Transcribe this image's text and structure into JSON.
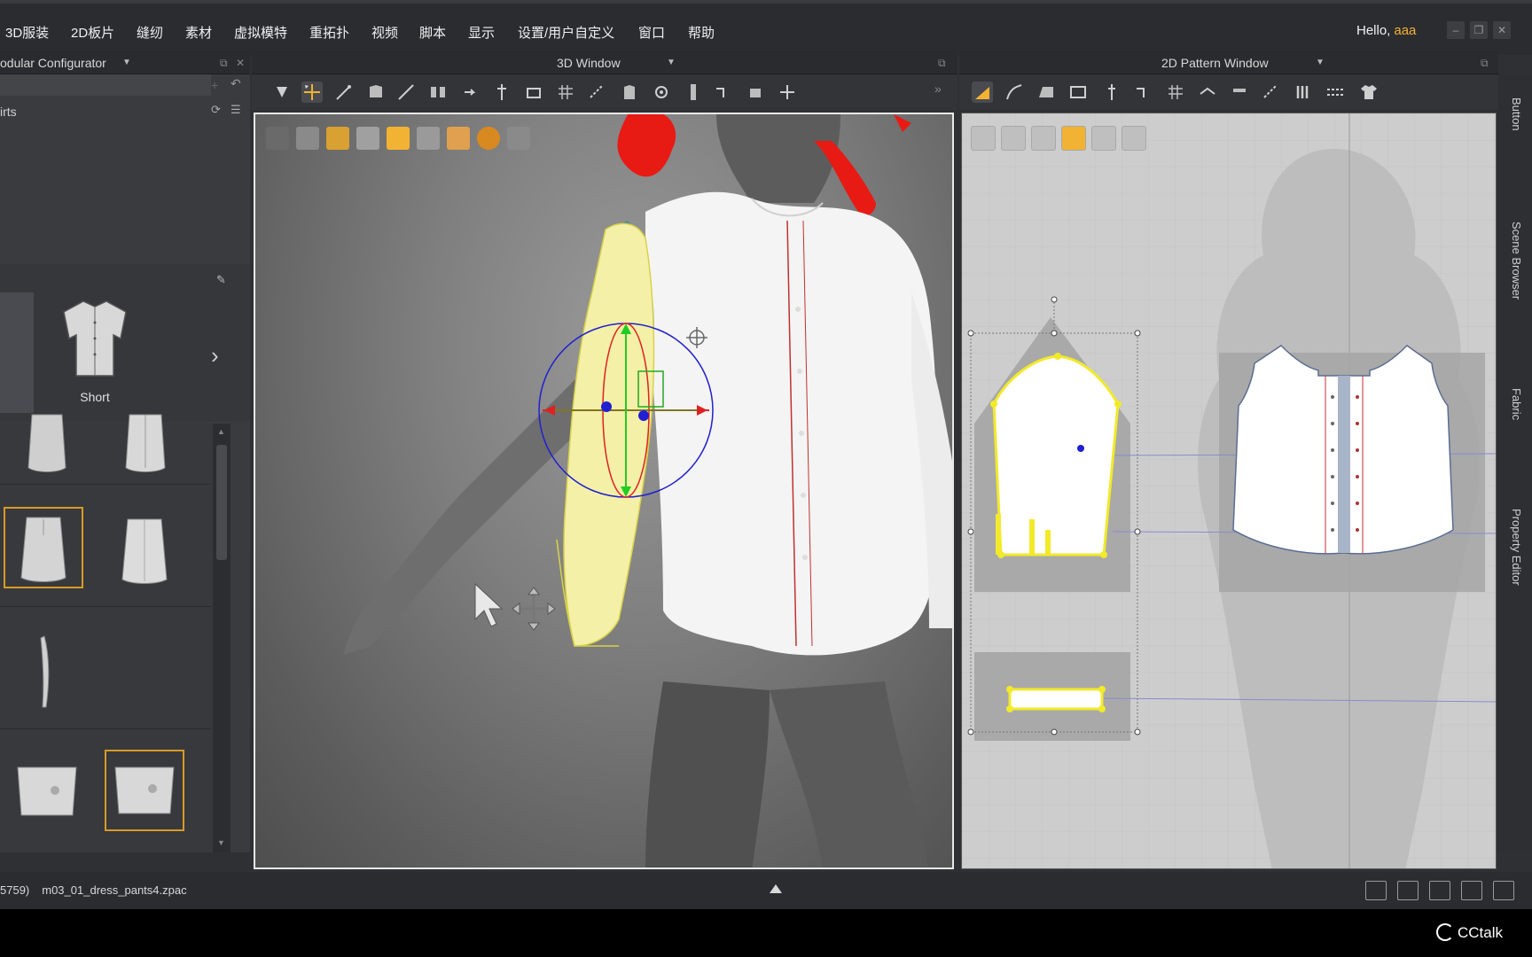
{
  "menu": {
    "items": [
      "3D服装",
      "2D板片",
      "缝纫",
      "素材",
      "虚拟模特",
      "重拓扑",
      "视频",
      "脚本",
      "显示",
      "设置/用户自定义",
      "窗口",
      "帮助"
    ]
  },
  "user": {
    "greeting": "Hello,",
    "name": "aaa"
  },
  "panels": {
    "left_title": "odular Configurator",
    "view3d_title": "3D Window",
    "view2d_title": "2D Pattern Window"
  },
  "left_panel": {
    "category": "irts",
    "style_label": "Short"
  },
  "side_tabs": [
    "Button",
    "Scene Browser",
    "Fabric",
    "Property Editor"
  ],
  "status": {
    "prefix": "5759)",
    "filename": "m03_01_dress_pants4.zpac"
  },
  "watermark": "CCtalk",
  "colors": {
    "accent": "#f2b233",
    "selection": "#d89a26",
    "gizmo_red": "#e02020",
    "gizmo_green": "#22cc22",
    "gizmo_blue": "#2020d0",
    "sleeve_yellow": "#f4f0a8",
    "hair_red": "#e81a14"
  },
  "icons": {
    "view3d_toolbar": [
      "select-mesh-icon",
      "move-icon",
      "edit-pattern-icon",
      "fold-icon",
      "line-icon",
      "arrangement-icon",
      "tack-icon",
      "pin-icon",
      "strap-icon",
      "grid-icon",
      "sew-icon",
      "garment-icon",
      "button-icon",
      "zip-icon",
      "measure-icon",
      "ruler-icon",
      "split-icon"
    ],
    "view2d_toolbar": [
      "edit-pattern-icon",
      "curve-icon",
      "polygon-icon",
      "rectangle-icon",
      "dart-icon",
      "trace-icon",
      "grid-icon",
      "fold-icon",
      "pleat-icon",
      "sew-icon",
      "column-icon",
      "baseline-icon",
      "shirt-icon"
    ]
  }
}
